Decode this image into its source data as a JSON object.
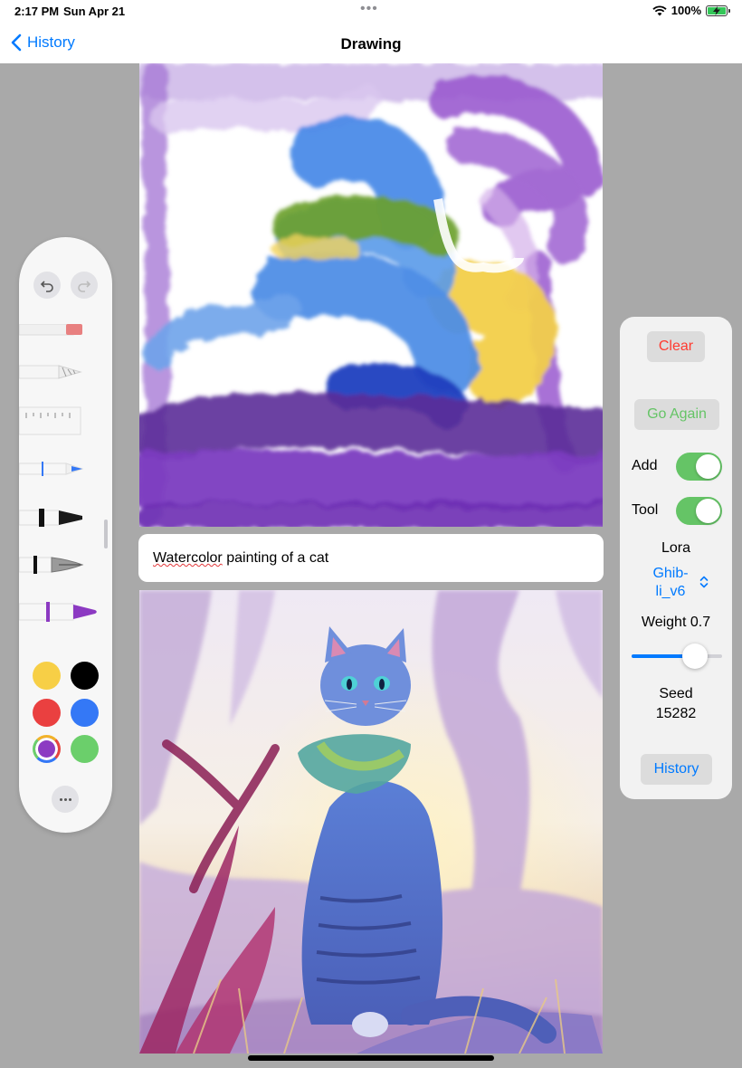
{
  "status_bar": {
    "time": "2:17 PM",
    "date": "Sun Apr 21",
    "battery": "100%",
    "battery_level": 1.0
  },
  "nav": {
    "back_label": "History",
    "title": "Drawing"
  },
  "prompt": {
    "word1": "Watercolor",
    "rest": " painting of a cat"
  },
  "palette": {
    "tools": [
      "eraser",
      "pencil",
      "ruler",
      "fine-pen",
      "marker",
      "fountain-pen",
      "watercolor-brush"
    ],
    "selected_tool": "watercolor-brush",
    "colors": [
      "#f7cf46",
      "#000000",
      "#ea4040",
      "#3478f6",
      "#8c3ac2",
      "#6bcf6b"
    ],
    "selected_color": "#8c3ac2"
  },
  "controls": {
    "clear_label": "Clear",
    "go_again_label": "Go Again",
    "add_label": "Add",
    "add_on": true,
    "tool_label": "Tool",
    "tool_on": true,
    "lora_label": "Lora",
    "lora_value_line1": "Ghib-",
    "lora_value_line2": "li_v6",
    "weight_label": "Weight 0.7",
    "weight_value": 0.7,
    "seed_label": "Seed",
    "seed_value": "15282",
    "history_label": "History"
  },
  "colors": {
    "accent": "#007aff",
    "destructive": "#ff3b30",
    "success": "#65c466",
    "canvas_background": "#a9a9a9"
  }
}
